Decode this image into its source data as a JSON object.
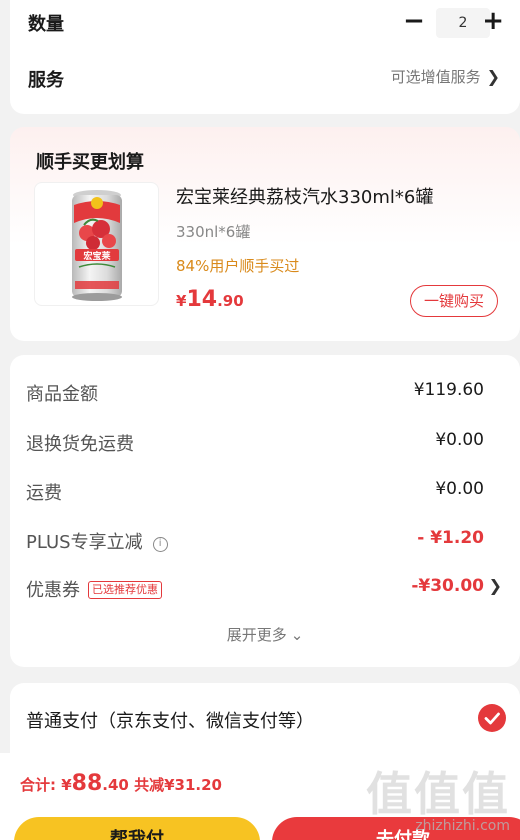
{
  "top": {
    "quantity_label": "数量",
    "quantity_value": "2",
    "minus": "−",
    "plus": "+",
    "service_label": "服务",
    "service_value": "可选增值服务",
    "chevron": "❯"
  },
  "recommend": {
    "title": "顺手买更划算",
    "product_name": "宏宝莱经典荔枝汽水330ml*6罐",
    "product_spec": "330nl*6罐",
    "product_tag": "84%用户顺手买过",
    "price_currency": "¥",
    "price_int": "14",
    "price_dec": ".90",
    "buy_button": "一键购买",
    "can_brand": "宏宝莱"
  },
  "summary": {
    "rows": [
      {
        "label": "商品金额",
        "value": "¥119.60"
      },
      {
        "label": "退换货免运费",
        "value": "¥0.00"
      },
      {
        "label": "运费",
        "value": "¥0.00"
      },
      {
        "label": "PLUS专享立减",
        "value": "- ¥1.20"
      },
      {
        "label": "优惠券",
        "value": "-¥30.00"
      }
    ],
    "info_icon": "i",
    "coupon_badge": "已选推荐优惠",
    "more": "展开更多",
    "more_chevron": "⌄"
  },
  "payment": {
    "label": "普通支付（京东支付、微信支付等）",
    "selected": true
  },
  "bottom": {
    "total_label": "合计: ",
    "total_currency": "¥",
    "total_int": "88",
    "total_dec": ".40",
    "discount": " 共减¥31.20",
    "friend_pay": "帮我付",
    "submit": "去付款"
  },
  "watermark": {
    "main": "值值值",
    "sub": "zhizhizhi.com"
  },
  "colors": {
    "accent": "#e4393c",
    "orange_tag": "#d98a1b",
    "yellow_button": "#f7c322",
    "background": "#f2f2f2"
  }
}
